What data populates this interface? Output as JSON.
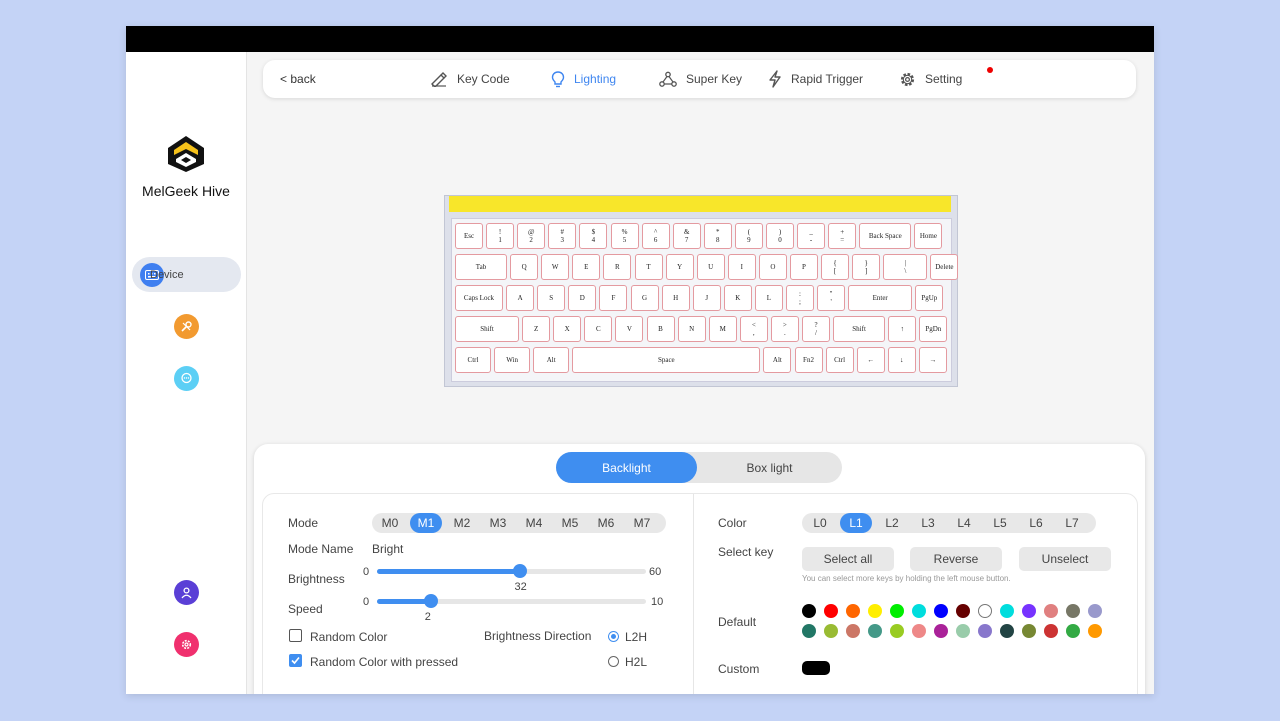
{
  "app": {
    "name": "MelGeek Hive"
  },
  "sidebar": {
    "device_label": "Device"
  },
  "topnav": {
    "back": "< back",
    "tabs": [
      {
        "label": "Key Code",
        "icon": "pen-ruler-icon"
      },
      {
        "label": "Lighting",
        "icon": "lightbulb-icon",
        "active": true
      },
      {
        "label": "Super Key",
        "icon": "network-icon"
      },
      {
        "label": "Rapid Trigger",
        "icon": "lightning-icon"
      },
      {
        "label": "Setting",
        "icon": "gear-icon"
      }
    ]
  },
  "keyboard": {
    "rows": [
      [
        "Esc",
        "!\n1",
        "@\n2",
        "#\n3",
        "$\n4",
        "%\n5",
        "^\n6",
        "&\n7",
        "*\n8",
        "(\n9",
        ")\n0",
        "_\n-",
        "+\n=",
        "Back Space",
        "Home"
      ],
      [
        "Tab",
        "Q",
        "W",
        "E",
        "R",
        "T",
        "Y",
        "U",
        "I",
        "O",
        "P",
        "{\n[",
        "}\n]",
        "|\n\\",
        "Delete"
      ],
      [
        "Caps Lock",
        "A",
        "S",
        "D",
        "F",
        "G",
        "H",
        "J",
        "K",
        "L",
        ":\n;",
        "\"\n'",
        "Enter",
        "PgUp"
      ],
      [
        "Shift",
        "Z",
        "X",
        "C",
        "V",
        "B",
        "N",
        "M",
        "<\n,",
        ">\n.",
        "?\n/",
        "Shift",
        "↑",
        "PgDn"
      ],
      [
        "Ctrl",
        "Win",
        "Alt",
        "Space",
        "Alt",
        "Fn2",
        "Ctrl",
        "←",
        "↓",
        "→"
      ]
    ]
  },
  "panel": {
    "tabs": [
      "Backlight",
      "Box light"
    ],
    "active_tab": "Backlight",
    "left": {
      "mode_label": "Mode",
      "modes": [
        "M0",
        "M1",
        "M2",
        "M3",
        "M4",
        "M5",
        "M6",
        "M7"
      ],
      "active_mode": "M1",
      "mode_name_label": "Mode Name",
      "mode_name_value": "Bright",
      "brightness": {
        "label": "Brightness",
        "min": "0",
        "max": "60",
        "value": 32,
        "value_text": "32"
      },
      "speed": {
        "label": "Speed",
        "min": "0",
        "max": "10",
        "value": 2,
        "value_text": "2"
      },
      "random_color": {
        "label": "Random Color",
        "checked": false
      },
      "random_color_pressed": {
        "label": "Random Color with pressed",
        "checked": true
      },
      "brightness_direction": {
        "label": "Brightness Direction",
        "options": [
          "L2H",
          "H2L"
        ],
        "selected": "L2H"
      }
    },
    "right": {
      "color_label": "Color",
      "layers": [
        "L0",
        "L1",
        "L2",
        "L3",
        "L4",
        "L5",
        "L6",
        "L7"
      ],
      "active_layer": "L1",
      "select_key_label": "Select key",
      "buttons": [
        "Select all",
        "Reverse",
        "Unselect"
      ],
      "hint": "You can select more keys by holding the left mouse button.",
      "default_label": "Default",
      "default_colors": [
        [
          "#000000",
          "#ff0000",
          "#ff6600",
          "#ffee00",
          "#00ee00",
          "#00dddd",
          "#0000ff",
          "#660000",
          "#ffffff",
          "#00dddd",
          "#7733ff",
          "#e08080",
          "#777766",
          "#9999cc"
        ],
        [
          "#227766",
          "#99bb33",
          "#cc7766",
          "#449988",
          "#99cc22",
          "#ee8888",
          "#aa2299",
          "#99ccaa",
          "#8877cc",
          "#224444",
          "#778833",
          "#cc3333",
          "#33aa44",
          "#ff9900"
        ]
      ],
      "custom_label": "Custom",
      "custom_color": "#000000"
    }
  },
  "colors": {
    "accent": "#3f8ef0",
    "device_icon": "#3f7ff0",
    "tools_icon": "#f29a30",
    "chat_icon": "#5ccff5",
    "user_icon": "#5a3fd6",
    "settings_icon": "#f0306e"
  }
}
